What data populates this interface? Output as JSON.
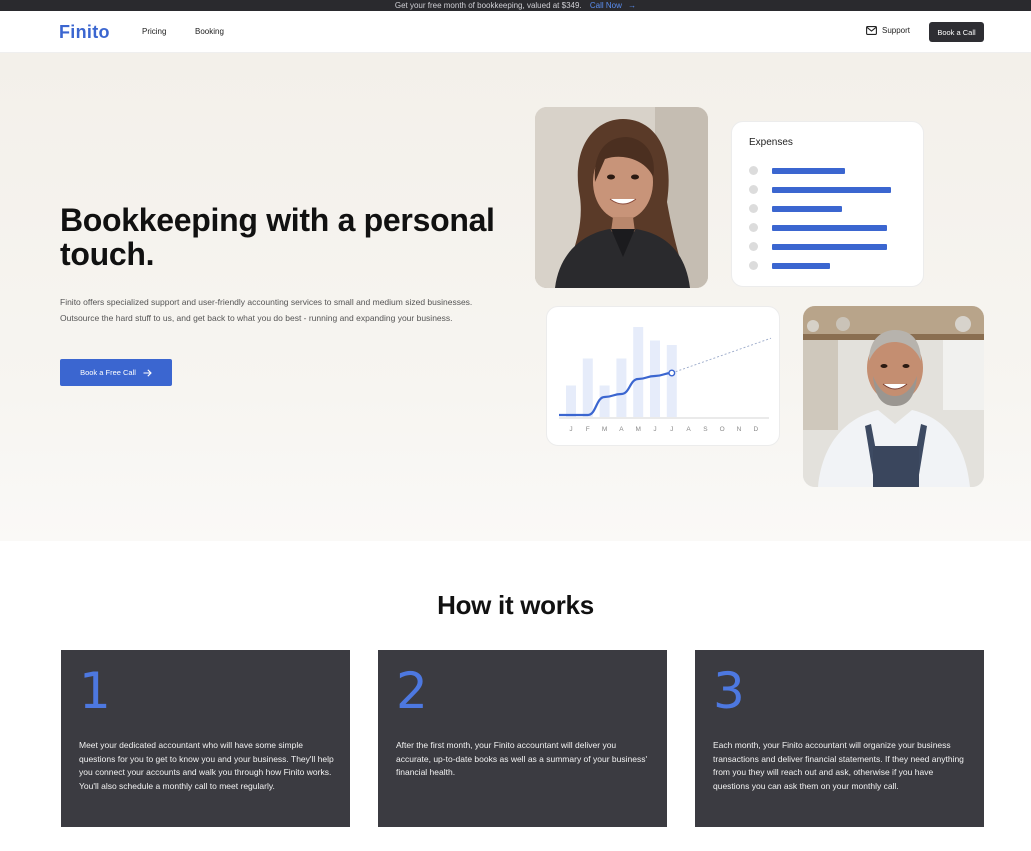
{
  "announcement": {
    "text": "Get your free month of bookkeeping, valued at $349.",
    "cta": "Call Now",
    "arrow": "→"
  },
  "nav": {
    "logo": "Finito",
    "links": [
      "Pricing",
      "Booking"
    ],
    "support_label": "Support",
    "support_icon": "mail-icon",
    "book_call_label": "Book a Call"
  },
  "hero": {
    "title": "Bookkeeping with a personal touch.",
    "description": "Finito offers specialized support and user-friendly accounting services to small and medium sized businesses. Outsource the hard stuff to us, and get back to what you do best - running and expanding your business.",
    "cta_label": "Book a Free Call",
    "cta_icon": "arrow-right-icon"
  },
  "expenses_card": {
    "title": "Expenses",
    "bars": [
      0.55,
      0.9,
      0.53,
      0.87,
      0.87,
      0.44
    ]
  },
  "chart_data": {
    "type": "line",
    "x": [
      "J",
      "F",
      "M",
      "A",
      "M",
      "J",
      "J",
      "A",
      "S",
      "O",
      "N",
      "D"
    ],
    "background_bars": [
      0.35,
      0.65,
      0.35,
      0.65,
      1.0,
      0.85,
      0.8,
      0,
      0,
      0,
      0,
      0
    ],
    "line": [
      0.0,
      0.0,
      0.3,
      0.35,
      0.6,
      0.65,
      0.7
    ],
    "projection": [
      0.7,
      0.85,
      0.98
    ],
    "colors": {
      "line": "#3b66d0",
      "bars": "#e6ecfa",
      "projection": "#9aa9c9"
    }
  },
  "how": {
    "title": "How it works",
    "steps": [
      {
        "number": "1",
        "text": "Meet your dedicated accountant who will have some simple questions for you to get to know you and your business. They'll help you connect your accounts and walk you through how Finito works. You'll also schedule a monthly call to meet regularly."
      },
      {
        "number": "2",
        "text": "After the first month, your Finito accountant will deliver you accurate, up-to-date books as well as a summary of your business' financial health."
      },
      {
        "number": "3",
        "text": "Each month, your Finito accountant will organize your business transactions and deliver financial statements. If they need anything from you they will reach out and ask, otherwise if you have questions you can ask them on your monthly call."
      }
    ]
  },
  "colors": {
    "accent": "#3b66d0",
    "dark": "#3b3b41"
  }
}
